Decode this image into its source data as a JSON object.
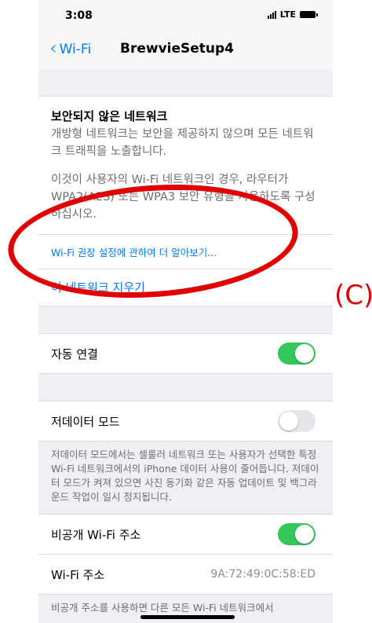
{
  "status": {
    "time": "3:08",
    "network": "LTE"
  },
  "nav": {
    "back_label": "Wi-Fi",
    "title": "BrewvieSetup4"
  },
  "security": {
    "heading": "보안되지 않은 네트워크",
    "body1": "개방형 네트워크는 보안을 제공하지 않으며 모든 네트워크 트래픽을 노출합니다.",
    "body2": "이것이 사용자의 Wi-Fi 네트워크인 경우, 라우터가 WPA2(AES) 또는 WPA3 보안 유형을 사용하도록 구성하십시오."
  },
  "learn_more": "Wi-Fi 권장 설정에 관하여 더 알아보기...",
  "forget": "이 네트워크 지우기",
  "auto_join": {
    "label": "자동 연결",
    "on": true
  },
  "low_data": {
    "label": "저데이터 모드",
    "on": false,
    "footnote": "저데이터 모드에서는 셀룰러 네트워크 또는 사용자가 선택한 특정 Wi-Fi 네트워크에서의 iPhone 데이터 사용이 줄어듭니다. 저데이터 모드가 켜져 있으면 사진 동기화 같은 자동 업데이트 및 백그라운드 작업이 일시 정지됩니다."
  },
  "private_address": {
    "label": "비공개 Wi-Fi 주소",
    "on": true
  },
  "wifi_address": {
    "label": "Wi-Fi 주소",
    "value": "9A:72:49:0C:58:ED"
  },
  "private_footnote": "비공개 주소를 사용하면 다른 모든 Wi-Fi 네트워크에서",
  "annotation": {
    "label": "(C)",
    "color": "#e00000"
  },
  "colors": {
    "accent": "#007aff",
    "toggle_on": "#34c759"
  }
}
